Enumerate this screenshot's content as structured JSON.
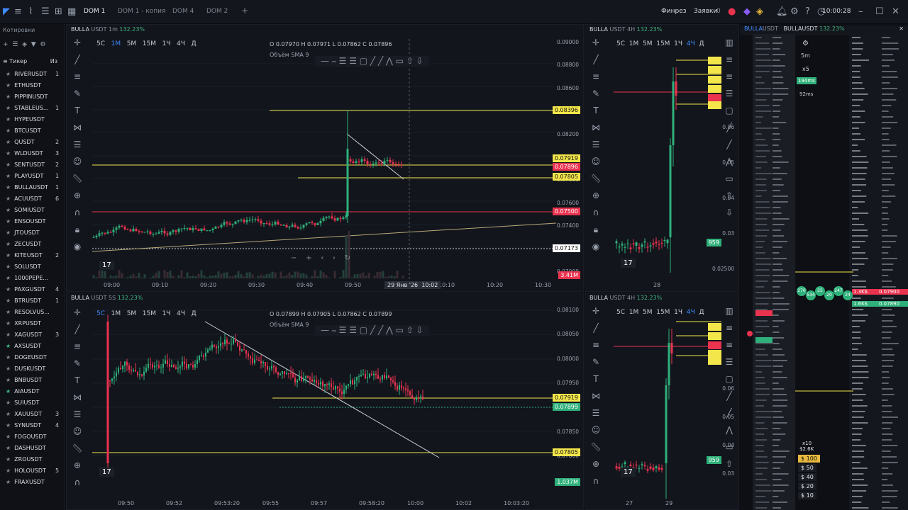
{
  "topbar": {
    "tabs": [
      "DOM 1",
      "DOM 1 - копия",
      "DOM 4",
      "DOM 2"
    ],
    "add": "+",
    "finance": "Финрез",
    "orders": "Заявки",
    "orders_count": "0",
    "time": "10:00:28"
  },
  "sidebar": {
    "title": "Котировки",
    "col_ticker": "Тикер",
    "col2": "Из",
    "tickers": [
      {
        "name": "RIVERUSDT",
        "count": "1",
        "fav": false
      },
      {
        "name": "ETHUSDT",
        "count": "",
        "fav": false
      },
      {
        "name": "PIPPINUSDT",
        "count": "",
        "fav": false
      },
      {
        "name": "STABLEUS...",
        "count": "1",
        "fav": false
      },
      {
        "name": "HYPEUSDT",
        "count": "",
        "fav": false
      },
      {
        "name": "BTCUSDT",
        "count": "",
        "fav": false
      },
      {
        "name": "QUSDT",
        "count": "2",
        "fav": false
      },
      {
        "name": "WLDUSDT",
        "count": "3",
        "fav": false
      },
      {
        "name": "SENTUSDT",
        "count": "2",
        "fav": false
      },
      {
        "name": "PLAYUSDT",
        "count": "1",
        "fav": false
      },
      {
        "name": "BULLAUSDT",
        "count": "1",
        "fav": false
      },
      {
        "name": "ACUUSDT",
        "count": "6",
        "fav": false
      },
      {
        "name": "SOMIUSDT",
        "count": "",
        "fav": false
      },
      {
        "name": "ENSOUSDT",
        "count": "",
        "fav": false
      },
      {
        "name": "JTOUSDT",
        "count": "",
        "fav": false
      },
      {
        "name": "ZECUSDT",
        "count": "",
        "fav": false
      },
      {
        "name": "KITEUSDT",
        "count": "2",
        "fav": false
      },
      {
        "name": "SOLUSDT",
        "count": "",
        "fav": false
      },
      {
        "name": "1000PEPE...",
        "count": "",
        "fav": false
      },
      {
        "name": "PAXGUSDT",
        "count": "4",
        "fav": false
      },
      {
        "name": "BTRUSDT",
        "count": "1",
        "fav": false
      },
      {
        "name": "RESOLVUS...",
        "count": "",
        "fav": false
      },
      {
        "name": "XRPUSDT",
        "count": "",
        "fav": false
      },
      {
        "name": "XAGUSDT",
        "count": "3",
        "fav": false
      },
      {
        "name": "AXSUSDT",
        "count": "",
        "fav": true
      },
      {
        "name": "DOGEUSDT",
        "count": "",
        "fav": false
      },
      {
        "name": "DUSKUSDT",
        "count": "",
        "fav": false
      },
      {
        "name": "BNBUSDT",
        "count": "",
        "fav": false
      },
      {
        "name": "AIAUSDT",
        "count": "",
        "fav": true
      },
      {
        "name": "SUIUSDT",
        "count": "",
        "fav": false
      },
      {
        "name": "XAUUSDT",
        "count": "3",
        "fav": false
      },
      {
        "name": "SYNUSDT",
        "count": "4",
        "fav": false
      },
      {
        "name": "FOGOUSDT",
        "count": "",
        "fav": false
      },
      {
        "name": "DASHUSDT",
        "count": "",
        "fav": false
      },
      {
        "name": "ZROUSDT",
        "count": "",
        "fav": false
      },
      {
        "name": "HOLOUSDT",
        "count": "5",
        "fav": false
      },
      {
        "name": "FRAXUSDT",
        "count": "",
        "fav": false
      }
    ]
  },
  "chart1": {
    "symbol": "BULLA",
    "quote": "USDT 1m",
    "pct": "132.23%",
    "tfs": [
      "5С",
      "1М",
      "5М",
      "15М",
      "1Ч",
      "4Ч",
      "Д"
    ],
    "ohlc": "O 0.07970 H 0.07971 L 0.07862 C 0.07896",
    "vol": "Объём SMA 9",
    "yticks": [
      "0.09000",
      "0.08800",
      "0.08600",
      "0.08400",
      "0.08200",
      "0.08000",
      "0.07800",
      "0.07600",
      "0.07400",
      "0.07200",
      "0.07000"
    ],
    "xticks": [
      "09:00",
      "09:10",
      "09:20",
      "09:30",
      "09:40",
      "09:50",
      "10:10",
      "10:20",
      "10:30"
    ],
    "crosshair": "29 Янв '26",
    "crosstime": "10:02",
    "labels": [
      {
        "t": "0.08396",
        "c": "#f3e64a"
      },
      {
        "t": "0.07919",
        "c": "#f3e64a"
      },
      {
        "t": "0.07896",
        "c": "#e9334f"
      },
      {
        "t": "0.07805",
        "c": "#f3e64a"
      },
      {
        "t": "0.07500",
        "c": "#e9334f"
      },
      {
        "t": "0.07173",
        "c": "#ffffff"
      },
      {
        "t": "3.41M",
        "c": "#e9334f"
      }
    ]
  },
  "chart2": {
    "symbol": "BULLA",
    "quote": "USDT 5S",
    "pct": "132.23%",
    "ohlc": "O 0.07899 H 0.07905 L 0.07862 C 0.07899",
    "vol": "Объём SMA 9",
    "yticks": [
      "0.08100",
      "0.08050",
      "0.08000",
      "0.07950",
      "0.07900",
      "0.07850",
      "0.07800"
    ],
    "xticks": [
      "09:50",
      "09:52",
      "09:53:20",
      "09:55",
      "09:57",
      "09:58:20",
      "10:00",
      "10:02",
      "10:03:20"
    ],
    "labels": [
      {
        "t": "0.07919",
        "c": "#f3e64a"
      },
      {
        "t": "0.07899",
        "c": "#2fb07a"
      },
      {
        "t": "0.07805",
        "c": "#f3e64a"
      },
      {
        "t": "1.037M",
        "c": "#2fb07a"
      }
    ]
  },
  "chart3": {
    "symbol": "BULLA",
    "quote": "USDT 4H",
    "pct": "132.23%",
    "yticks": [
      "0.06",
      "0.05",
      "0.04",
      "0.03",
      "0.02500"
    ],
    "xticks": [
      "28"
    ],
    "label959": "959"
  },
  "chart4": {
    "symbol": "BULLA",
    "quote": "USDT 4H",
    "pct": "132.23%",
    "yticks": [
      "0.06",
      "0.05",
      "0.04",
      "0.03"
    ],
    "xticks": [
      "27",
      "29"
    ],
    "label959": "959"
  },
  "dom": {
    "sym1": "BULLA",
    "sym1_quote": "USDT",
    "sym2": "BULLA",
    "sym2_quote": "USDT",
    "pct": "132.23%",
    "tf": "5m",
    "mult": "x5",
    "lat1": "194ms",
    "lat2": "92ms",
    "mult2": "x10",
    "vol2": "$2.6K",
    "amounts": [
      "$ 100",
      "$ 50",
      "$ 40",
      "$ 20",
      "$ 10"
    ],
    "big1": "1.3K$",
    "big2": "1.6K$",
    "price1": "0.07900",
    "price2": "0.07890",
    "cluster": [
      "270",
      "534",
      "25",
      "20",
      "247",
      "24"
    ]
  }
}
